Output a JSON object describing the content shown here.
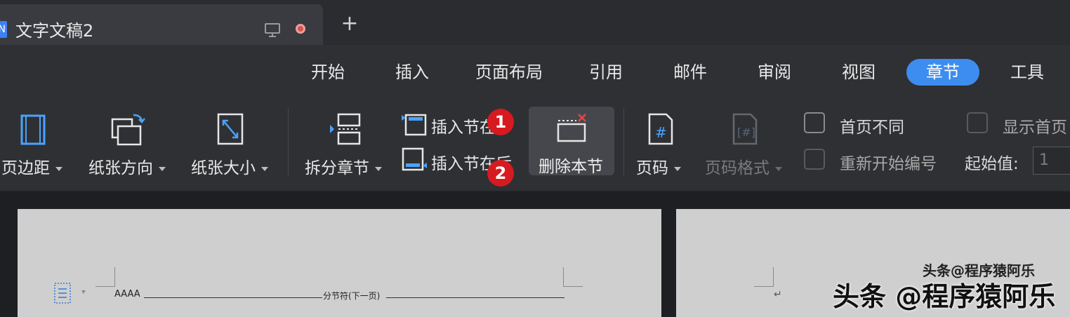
{
  "tab": {
    "title": "文字文稿2",
    "icon_letter": "N",
    "new_tab_label": "+"
  },
  "menu": {
    "items": [
      "开始",
      "插入",
      "页面布局",
      "引用",
      "邮件",
      "审阅",
      "视图",
      "章节",
      "工具"
    ],
    "active": "章节",
    "accent_color": "#3d8df0"
  },
  "toolbar": {
    "margins_label": "页边距",
    "orientation_label": "纸张方向",
    "size_label": "纸张大小",
    "split_section_label": "拆分章节",
    "insert_before_label": "插入节在",
    "insert_after_label": "插入节在后",
    "delete_section_label": "删除本节",
    "page_number_label": "页码",
    "page_number_format_label": "页码格式",
    "first_page_diff_label": "首页不同",
    "show_first_page_label": "显示首页",
    "restart_numbering_label": "重新开始编号",
    "start_value_label": "起始值:",
    "start_value": "1"
  },
  "badges": {
    "one": "1",
    "two": "2",
    "color": "#d71920"
  },
  "document": {
    "line_text": "AAAA",
    "section_break_label": "分节符(下一页)",
    "watermark_small": "头条@程序猿阿乐",
    "watermark_big": "头条 @程序猿阿乐"
  }
}
